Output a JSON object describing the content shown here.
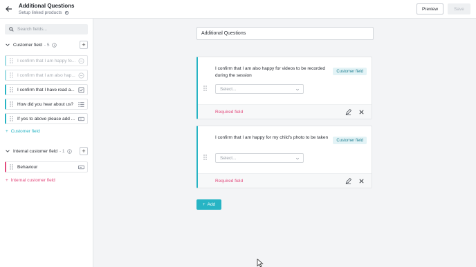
{
  "header": {
    "title": "Additional Questions",
    "subtitle": "Setup linked products",
    "preview_label": "Preview",
    "save_label": "Save"
  },
  "sidebar": {
    "search_placeholder": "Search fields...",
    "customer_section": {
      "name": "Customer field",
      "count": "- 5",
      "items": [
        {
          "label": "I confirm that I am happy fo..."
        },
        {
          "label": "I confirm that I am also hap..."
        },
        {
          "label": "I confirm that I have read a..."
        },
        {
          "label": "How did you hear about us?"
        },
        {
          "label": "If yes to above please add ..."
        }
      ],
      "add_label": "Customer field"
    },
    "internal_section": {
      "name": "Internal customer field",
      "count": "- 1",
      "items": [
        {
          "label": "Behaviour"
        }
      ],
      "add_label": "Internal customer field"
    }
  },
  "main": {
    "name_value": "Additional Questions",
    "questions": [
      {
        "text": "I confirm that I am also happy for videos to be recorded during the session",
        "tag": "Customer field",
        "select_placeholder": "Select...",
        "required_label": "Required field"
      },
      {
        "text": "I confirm that I am happy for my child's photo to be taken",
        "tag": "Customer field",
        "select_placeholder": "Select...",
        "required_label": "Required field"
      }
    ],
    "add_label": "Add"
  },
  "colors": {
    "accent": "#27b4c4",
    "pink": "#e24b7d"
  },
  "icons": [
    "back-arrow-icon",
    "gear-icon",
    "search-icon",
    "chevron-down-icon",
    "info-icon",
    "plus-icon",
    "drag-handle-icon",
    "checkbox-icon",
    "list-icon",
    "text-input-icon",
    "edit-icon",
    "close-icon",
    "cursor-icon"
  ]
}
